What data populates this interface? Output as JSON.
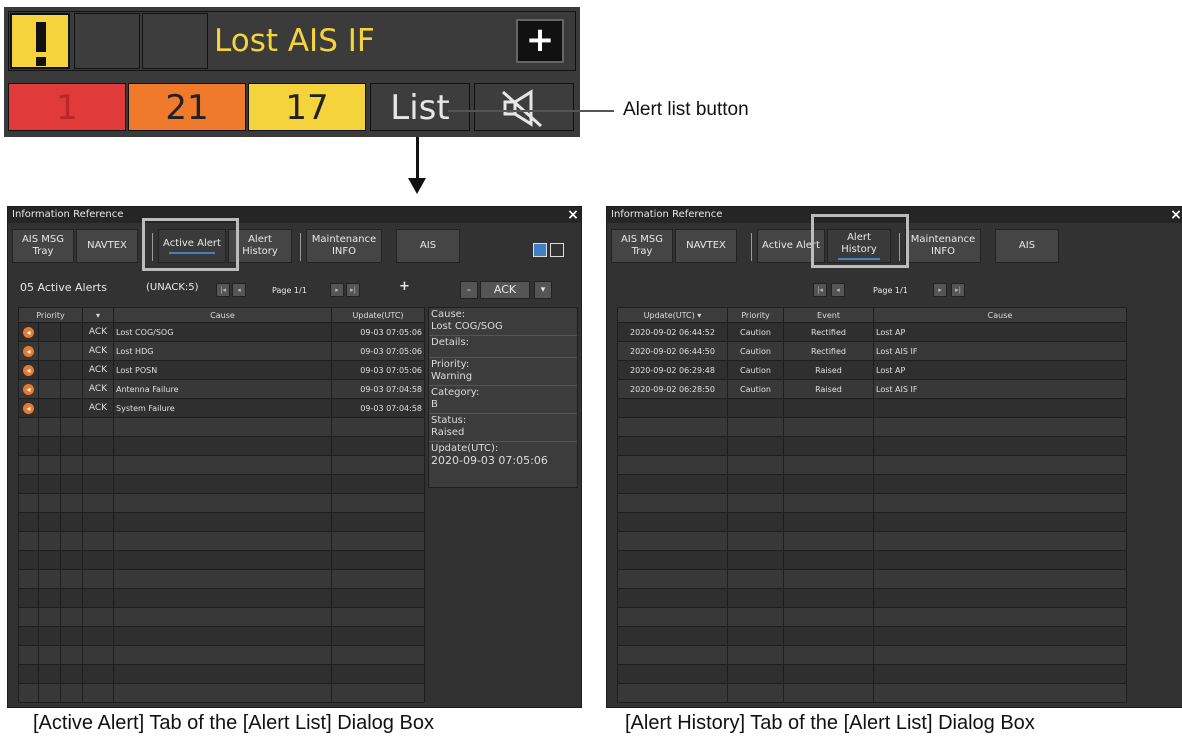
{
  "alert_panel": {
    "title": "Lost AIS IF",
    "plus_label": "+",
    "counts": [
      {
        "value": "1",
        "color": "#e03a3a"
      },
      {
        "value": "21",
        "color": "#f07a2c"
      },
      {
        "value": "17",
        "color": "#f5d33d"
      }
    ],
    "list_label": "List",
    "callout": "Alert list button"
  },
  "dialog_left": {
    "title": "Information Reference",
    "close": "×",
    "tabs": [
      "AIS MSG Tray",
      "NAVTEX",
      "Active Alert",
      "Alert History",
      "Maintenance INFO",
      "AIS"
    ],
    "summary": "05 Active Alerts",
    "unack": "(UNACK:5)",
    "page": "Page 1/1",
    "plus": "+",
    "minus": "-",
    "ack": "ACK",
    "dropdown": "▾",
    "headers": {
      "priority": "Priority",
      "cause": "Cause",
      "update": "Update(UTC)"
    },
    "rows": [
      {
        "ack": "ACK",
        "cause": "Lost COG/SOG",
        "update": "09-03 07:05:06"
      },
      {
        "ack": "ACK",
        "cause": "Lost HDG",
        "update": "09-03 07:05:06"
      },
      {
        "ack": "ACK",
        "cause": "Lost POSN",
        "update": "09-03 07:05:06"
      },
      {
        "ack": "ACK",
        "cause": "Antenna Failure",
        "update": "09-03 07:04:58"
      },
      {
        "ack": "ACK",
        "cause": "System Failure",
        "update": "09-03 07:04:58"
      }
    ],
    "details": {
      "cause_label": "Cause:",
      "cause_value": "Lost COG/SOG",
      "details_label": "Details:",
      "priority_label": "Priority:",
      "priority_value": "Warning",
      "category_label": "Category:",
      "category_value": "B",
      "status_label": "Status:",
      "status_value": "Raised",
      "update_label": "Update(UTC):",
      "update_value": "2020-09-03 07:05:06"
    },
    "caption": "[Active Alert] Tab of the [Alert List] Dialog Box"
  },
  "dialog_right": {
    "title": "Information Reference",
    "close": "×",
    "tabs": [
      "AIS MSG Tray",
      "NAVTEX",
      "Active Alert",
      "Alert History",
      "Maintenance INFO",
      "AIS"
    ],
    "page": "Page 1/1",
    "headers": {
      "update": "Update(UTC)",
      "priority": "Priority",
      "event": "Event",
      "cause": "Cause"
    },
    "rows": [
      {
        "update": "2020-09-02 06:44:52",
        "priority": "Caution",
        "event": "Rectified",
        "cause": "Lost AP"
      },
      {
        "update": "2020-09-02 06:44:50",
        "priority": "Caution",
        "event": "Rectified",
        "cause": "Lost AIS IF"
      },
      {
        "update": "2020-09-02 06:29:48",
        "priority": "Caution",
        "event": "Raised",
        "cause": "Lost AP"
      },
      {
        "update": "2020-09-02 06:28:50",
        "priority": "Caution",
        "event": "Raised",
        "cause": "Lost AIS IF"
      }
    ],
    "caption": "[Alert History] Tab of the [Alert List] Dialog Box"
  }
}
